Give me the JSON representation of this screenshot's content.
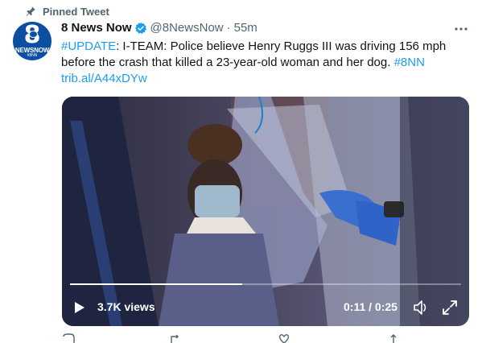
{
  "pinned": {
    "label": "Pinned Tweet",
    "icon": "pin-icon"
  },
  "author": {
    "avatar": {
      "brand_number": "8",
      "brand_name": "NEWSNOW",
      "brand_tag": "#8NN",
      "color": "#0b4ea2"
    },
    "name": "8 News Now",
    "verified": true,
    "handle": "@8NewsNow",
    "separator": "·",
    "time": "55m"
  },
  "tweet": {
    "hashtag_lead": "#UPDATE",
    "body": ": I-TEAM: Police believe Henry Ruggs III was driving 156 mph before the crash that killed a 23-year-old woman and her dog. ",
    "hashtag_tail": "#8NN",
    "link": "trib.al/A44xDYw"
  },
  "video": {
    "views": "3.7K views",
    "current_time": "0:11",
    "duration": "0:25",
    "time_display": "0:11 / 0:25",
    "progress": 0.44
  },
  "colors": {
    "accent": "#1d9bf0",
    "text": "#0f1419",
    "muted": "#536471"
  }
}
